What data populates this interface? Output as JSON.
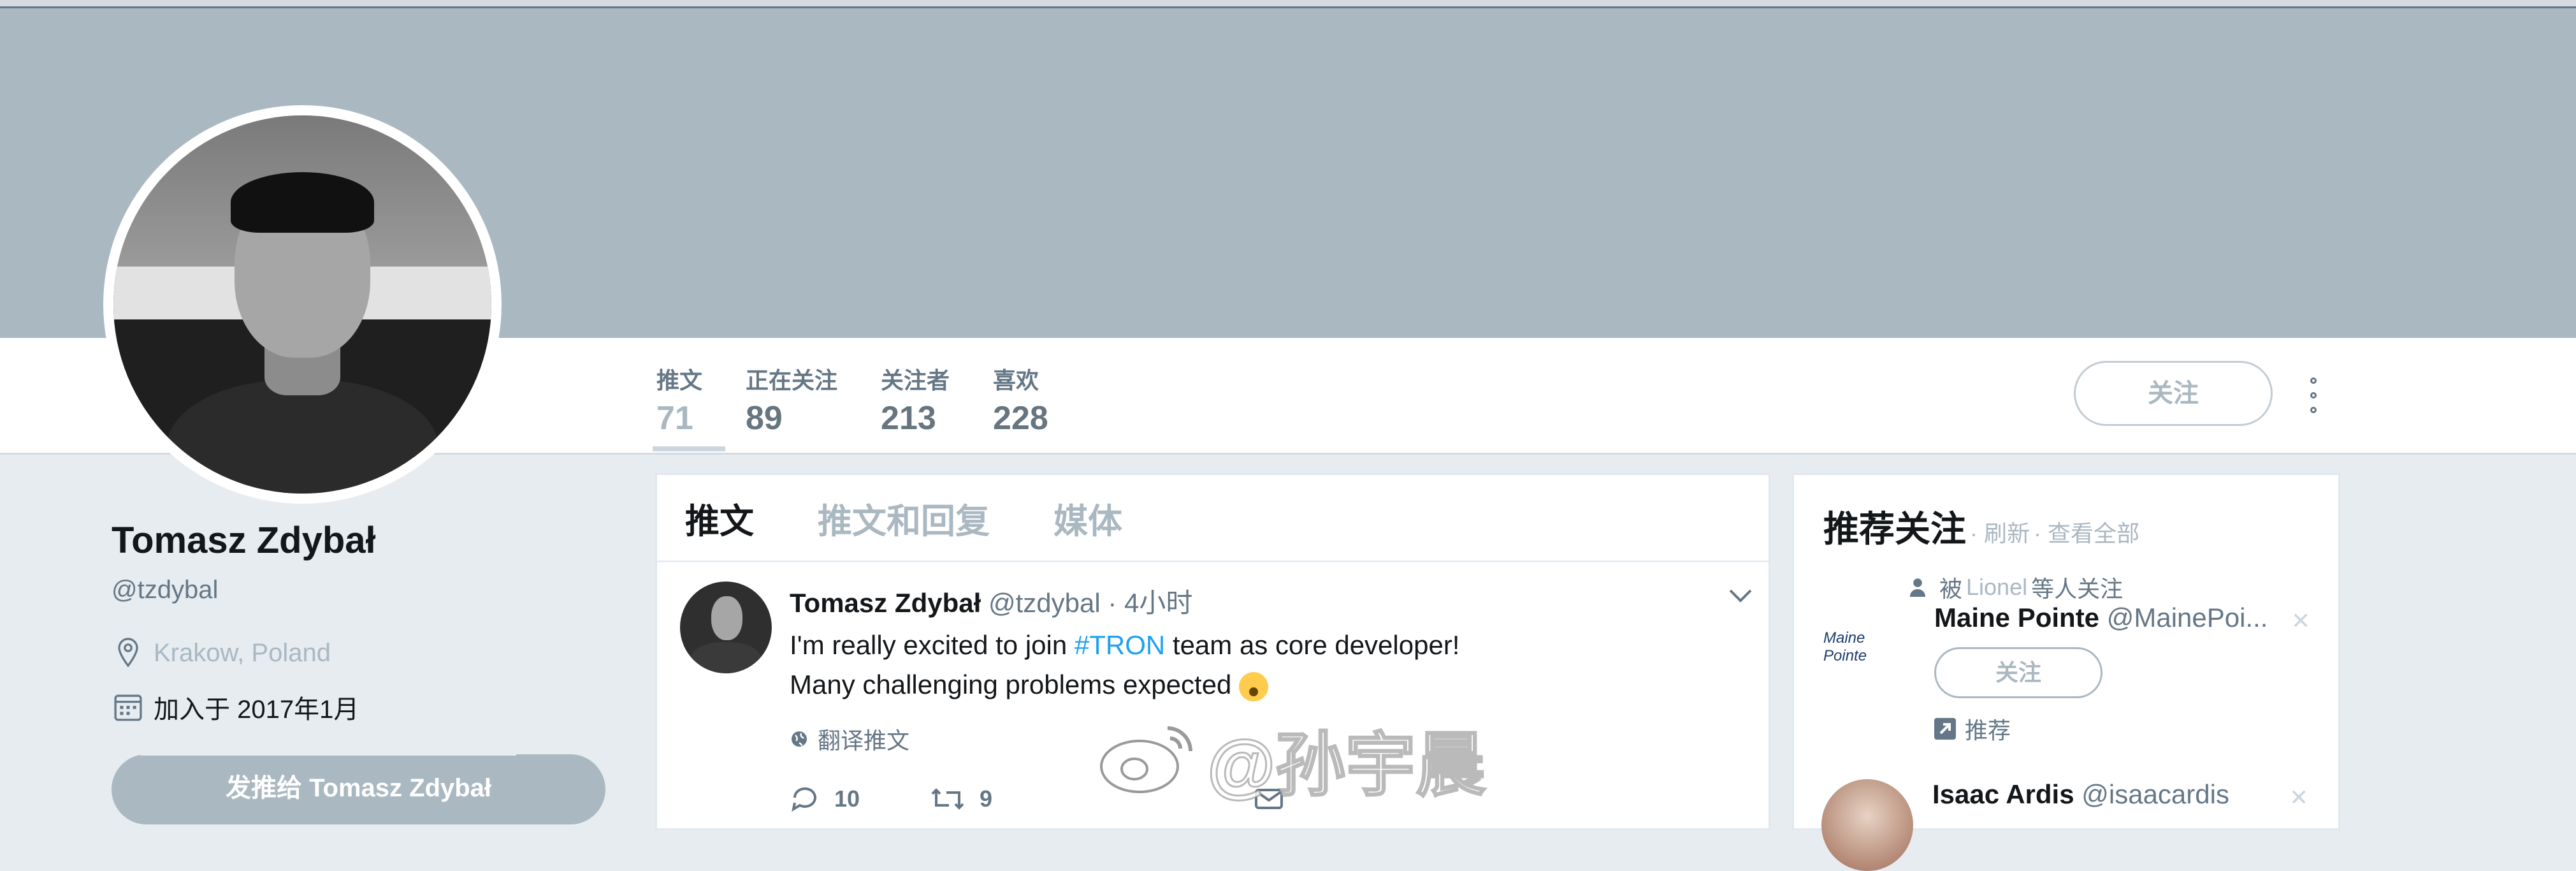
{
  "profile": {
    "name": "Tomasz Zdybał",
    "handle": "@tzdybal",
    "location": "Krakow, Poland",
    "joined": "加入于 2017年1月",
    "tweet_to_label": "发推给 Tomasz Zdybał"
  },
  "nav": {
    "stats": [
      {
        "label": "推文",
        "value": "71"
      },
      {
        "label": "正在关注",
        "value": "89"
      },
      {
        "label": "关注者",
        "value": "213"
      },
      {
        "label": "喜欢",
        "value": "228"
      }
    ],
    "follow_label": "关注"
  },
  "timeline": {
    "tabs": [
      "推文",
      "推文和回复",
      "媒体"
    ],
    "tweet": {
      "name": "Tomasz Zdybał",
      "handle": "@tzdybal",
      "time": "· 4小时",
      "line1_pre": "I'm really excited to join ",
      "hashtag": "#TRON",
      "line1_post": " team as core developer!",
      "line2": "Many challenging problems expected",
      "translate": "翻译推文",
      "replies": "10",
      "retweets": "9"
    }
  },
  "watermark": "@孙宇晨",
  "suggestions": {
    "title": "推荐关注",
    "refresh": "· 刷新",
    "view_all": "· 查看全部",
    "items": [
      {
        "via_prefix": "被",
        "via_user": "Lionel",
        "via_suffix": "等人关注",
        "logo_text": "Maine Pointe",
        "name": "Maine Pointe",
        "handle": "@MainePoi...",
        "follow_label": "关注",
        "rec_label": "推荐"
      },
      {
        "name": "Isaac Ardis",
        "handle": "@isaacardis"
      }
    ]
  },
  "colors": {
    "banner": "#aab8c2",
    "background": "#e6ecf0",
    "link": "#1da1f2",
    "muted": "#657786"
  }
}
